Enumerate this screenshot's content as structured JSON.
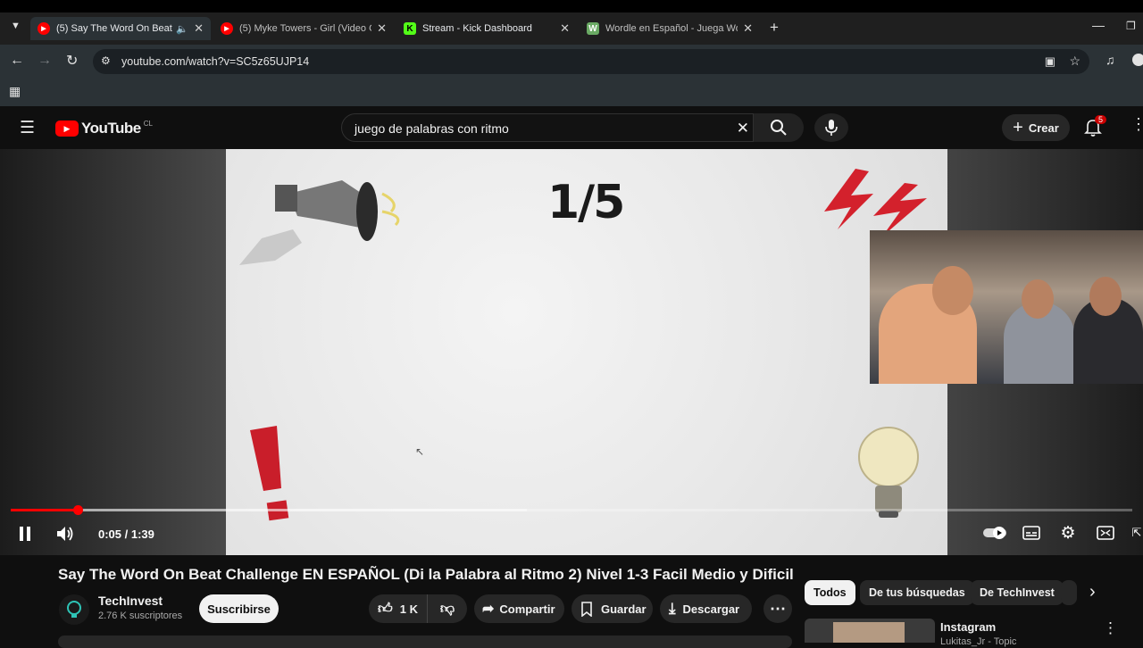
{
  "browser": {
    "tabs": [
      {
        "title": "(5) Say The Word On Beat C",
        "favicon": "youtube-icon",
        "active": true,
        "audio": true
      },
      {
        "title": "(5) Myke Towers - Girl (Video O",
        "favicon": "youtube-icon",
        "active": false
      },
      {
        "title": "Stream - Kick Dashboard",
        "favicon": "kick-icon",
        "active": false
      },
      {
        "title": "Wordle en Español - Juega Wor",
        "favicon": "wordle-icon",
        "active": false
      }
    ],
    "kick_letter": "K",
    "wordle_letter": "W",
    "url": "youtube.com/watch?v=SC5z65UJP14"
  },
  "youtube": {
    "logo_text": "YouTube",
    "country_code": "CL",
    "search_query": "juego de palabras con ritmo",
    "create_label": "Crear",
    "notification_count": "5"
  },
  "player": {
    "slide_counter": "1/5",
    "time": "0:05 / 1:39",
    "progress_fraction": 0.06,
    "buffer_fraction": 0.46,
    "autoplay_on": true
  },
  "video": {
    "title": "Say The Word On Beat Challenge EN ESPAÑOL (Di la Palabra al Ritmo 2) Nivel 1-3 Facil Medio y Dificil",
    "channel": "TechInvest",
    "subscribers": "2.76 K suscriptores",
    "subscribe_label": "Suscribirse",
    "likes": "1 K",
    "share_label": "Compartir",
    "save_label": "Guardar",
    "download_label": "Descargar"
  },
  "chips": [
    "Todos",
    "De tus búsquedas",
    "De TechInvest"
  ],
  "recommendation": {
    "title": "Instagram",
    "subtitle": "Lukitas_Jr - Topic"
  },
  "colors": {
    "accent": "#ff0000",
    "chrome_bg": "#2b3236",
    "page_bg": "#0f0f0f"
  }
}
